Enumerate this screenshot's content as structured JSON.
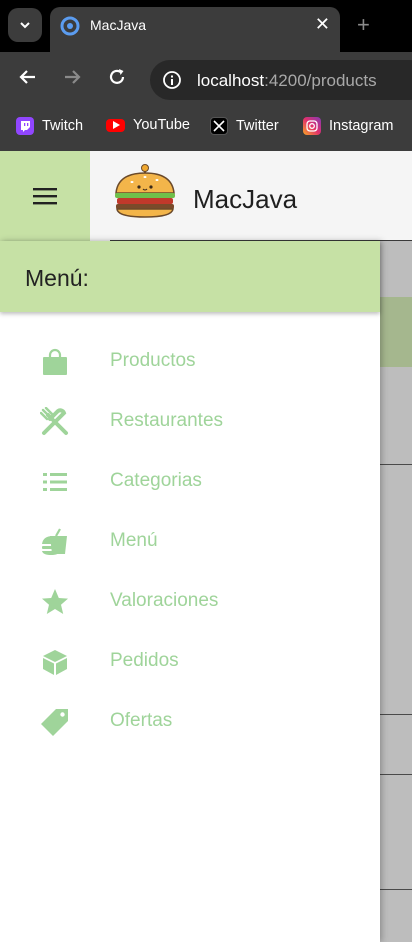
{
  "browser": {
    "tab_title": "MacJava",
    "tab_close": "✕",
    "new_tab": "+",
    "url_host": "localhost",
    "url_path": ":4200/products",
    "bookmarks": [
      {
        "label": "Twitch",
        "icon": "twitch-icon",
        "color": "#9146ff"
      },
      {
        "label": "YouTube",
        "icon": "youtube-icon",
        "color": "#ff0000"
      },
      {
        "label": "Twitter",
        "icon": "x-twitter-icon",
        "color": "#000000"
      },
      {
        "label": "Instagram",
        "icon": "instagram-icon",
        "color": "#e1306c"
      }
    ]
  },
  "app": {
    "brand": "MacJava",
    "drawer_title": "Menú:",
    "menu": [
      {
        "label": "Productos",
        "icon": "shopping-bag-icon"
      },
      {
        "label": "Restaurantes",
        "icon": "restaurant-icon"
      },
      {
        "label": "Categorias",
        "icon": "list-icon"
      },
      {
        "label": "Menú",
        "icon": "lunch-dining-icon"
      },
      {
        "label": "Valoraciones",
        "icon": "star-icon"
      },
      {
        "label": "Pedidos",
        "icon": "package-icon"
      },
      {
        "label": "Ofertas",
        "icon": "tag-icon"
      }
    ]
  },
  "colors": {
    "accent": "#c6e1a5",
    "menu_text": "#9fd49a",
    "menu_icon": "#9fd49a"
  }
}
